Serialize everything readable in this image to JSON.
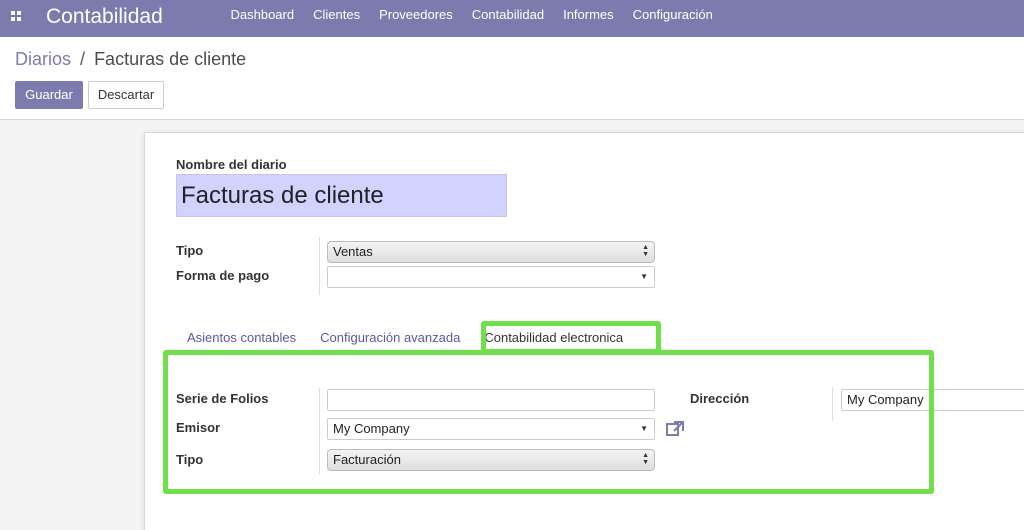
{
  "navbar": {
    "brand": "Contabilidad",
    "menu": [
      "Dashboard",
      "Clientes",
      "Proveedores",
      "Contabilidad",
      "Informes",
      "Configuración"
    ]
  },
  "breadcrumb": {
    "parent": "Diarios",
    "separator": "/",
    "current": "Facturas de cliente"
  },
  "buttons": {
    "save": "Guardar",
    "discard": "Descartar"
  },
  "form": {
    "name_label": "Nombre del diario",
    "name_value": "Facturas de cliente",
    "type_label": "Tipo",
    "type_value": "Ventas",
    "payment_label": "Forma de pago",
    "payment_value": ""
  },
  "tabs": [
    "Asientos contables",
    "Configuración avanzada",
    "Contabilidad electronica"
  ],
  "tab_content": {
    "serie_label": "Serie de Folios",
    "serie_value": "",
    "emisor_label": "Emisor",
    "emisor_value": "My Company",
    "tipo_label": "Tipo",
    "tipo_value": "Facturación",
    "direccion_label": "Dirección",
    "direccion_value": "My Company"
  },
  "colors": {
    "brand": "#7c7bad",
    "highlight": "#6fe04a",
    "title_bg": "#d2d2ff"
  }
}
